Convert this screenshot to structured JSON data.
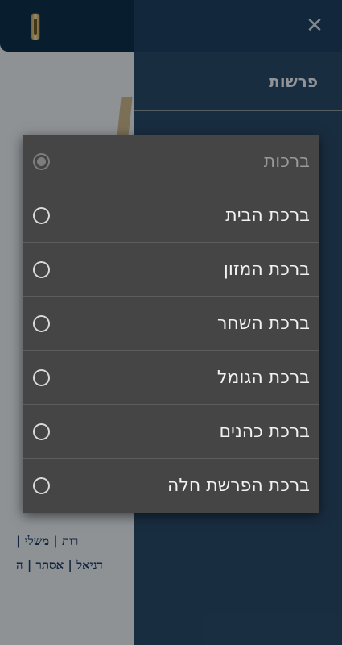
{
  "background": {
    "links_row1": "רות | משלי |",
    "links_row2": "דניאל | אסתר | ה"
  },
  "drawer": {
    "items": [
      {
        "label": "פרשות"
      },
      {
        "label": ""
      },
      {
        "label": ""
      },
      {
        "label": ""
      },
      {
        "label": ""
      }
    ]
  },
  "dialog": {
    "title": "ברכות",
    "options": [
      {
        "label": "ברכת הבית",
        "selected": false
      },
      {
        "label": "ברכת המזון",
        "selected": false
      },
      {
        "label": "ברכת השחר",
        "selected": false
      },
      {
        "label": "ברכת הגומל",
        "selected": false
      },
      {
        "label": "ברכת כהנים",
        "selected": false
      },
      {
        "label": "ברכת הפרשת חלה",
        "selected": false
      }
    ]
  },
  "colors": {
    "header": "#0d2f49",
    "drawer": "#294a68",
    "dialog": "#454545"
  },
  "icons": {
    "close": "close-icon",
    "app": "scroll-icon"
  }
}
